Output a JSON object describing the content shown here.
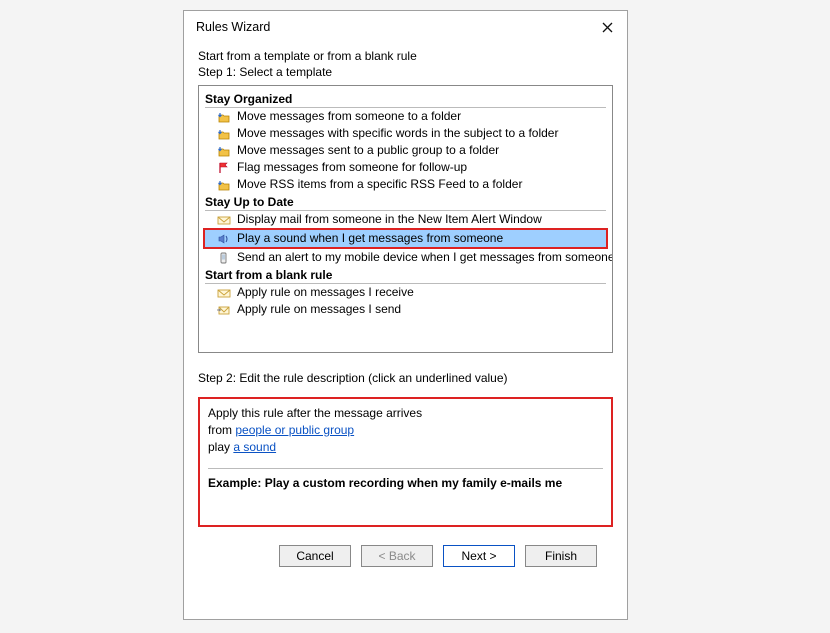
{
  "dialog": {
    "title": "Rules Wizard"
  },
  "intro": {
    "line1": "Start from a template or from a blank rule",
    "line2": "Step 1: Select a template"
  },
  "sections": {
    "organized": {
      "header": "Stay Organized",
      "items": [
        "Move messages from someone to a folder",
        "Move messages with specific words in the subject to a folder",
        "Move messages sent to a public group to a folder",
        "Flag messages from someone for follow-up",
        "Move RSS items from a specific RSS Feed to a folder"
      ]
    },
    "uptodate": {
      "header": "Stay Up to Date",
      "items": [
        "Display mail from someone in the New Item Alert Window",
        "Play a sound when I get messages from someone",
        "Send an alert to my mobile device when I get messages from someone"
      ],
      "selected_index": 1
    },
    "blank": {
      "header": "Start from a blank rule",
      "items": [
        "Apply rule on messages I receive",
        "Apply rule on messages I send"
      ]
    }
  },
  "step2": {
    "label": "Step 2: Edit the rule description (click an underlined value)",
    "line1": "Apply this rule after the message arrives",
    "line2_prefix": "from ",
    "line2_link": "people or public group",
    "line3_prefix": "play ",
    "line3_link": "a sound",
    "example": "Example: Play a custom recording when my family e-mails me"
  },
  "buttons": {
    "cancel": "Cancel",
    "back": "< Back",
    "next": "Next >",
    "finish": "Finish"
  }
}
